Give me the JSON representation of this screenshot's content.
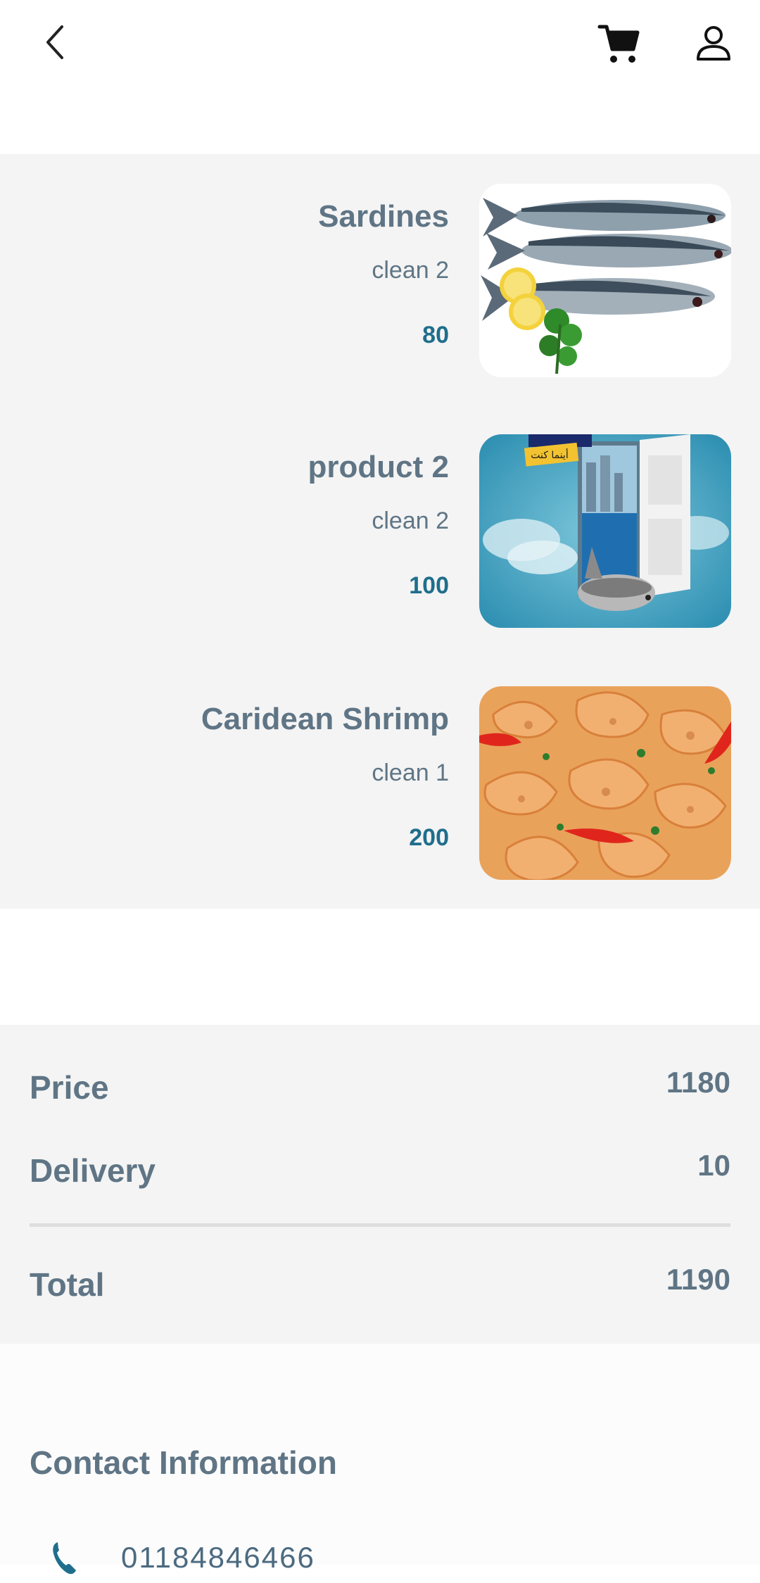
{
  "header": {
    "back_icon": "chevron-left-icon",
    "cart_icon": "shopping-cart-icon",
    "user_icon": "user-profile-icon"
  },
  "cart_items": [
    {
      "name": "Sardines",
      "option": "clean 2",
      "price": "80",
      "image": "mackerel fish with lemon and parsley"
    },
    {
      "name": "product 2",
      "option": "clean 2",
      "price": "100",
      "image": "salmon jumping through door over sea"
    },
    {
      "name": "Caridean Shrimp",
      "option": "clean 1",
      "price": "200",
      "image": "cooked shrimp with red chili"
    }
  ],
  "summary": {
    "price_label": "Price",
    "price_value": "1180",
    "delivery_label": "Delivery",
    "delivery_value": "10",
    "total_label": "Total",
    "total_value": "1190"
  },
  "contact": {
    "title": "Contact Information",
    "phone": "01184846466",
    "phone_icon": "phone-icon"
  },
  "colors": {
    "text_primary": "#5f7585",
    "price_accent": "#1f6e8c",
    "section_bg": "#f4f4f4"
  },
  "image_text": {
    "promo_badge": "أينما كنت"
  }
}
